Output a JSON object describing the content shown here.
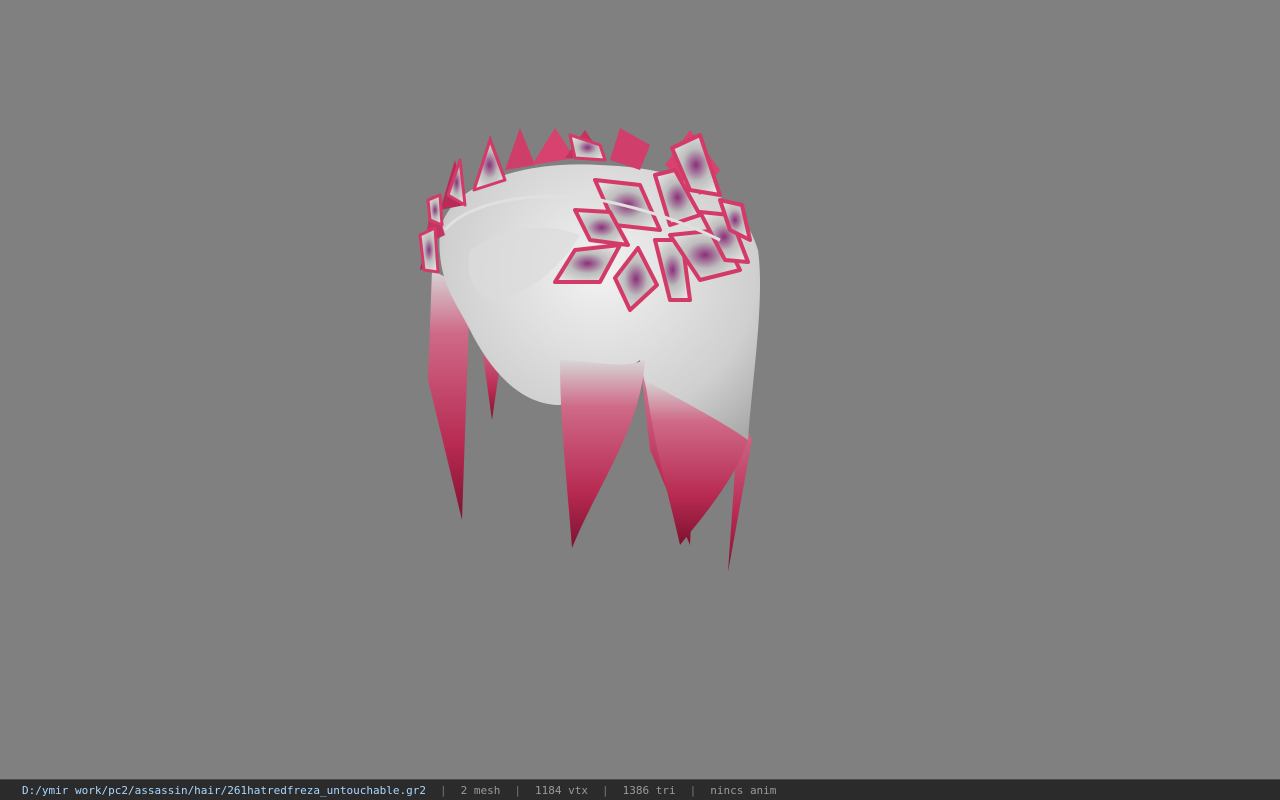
{
  "viewport": {
    "background": "#808080",
    "model_name": "hair-model",
    "colors": {
      "hair_light": "#e8e8e8",
      "hair_mid": "#b9b9b9",
      "hair_tip": "#c2305a",
      "hair_tip_dark": "#8a1334",
      "leaf_edge": "#d33a68",
      "leaf_fill": "#cfcfcf",
      "leaf_vein": "#7a2c6a"
    }
  },
  "statusbar": {
    "file_path": "D:/ymir work/pc2/assassin/hair/261hatredfreza_untouchable.gr2",
    "separator": "|",
    "mesh": "2 mesh",
    "vtx": "1184 vtx",
    "tri": "1386 tri",
    "anim": "nincs anim"
  }
}
